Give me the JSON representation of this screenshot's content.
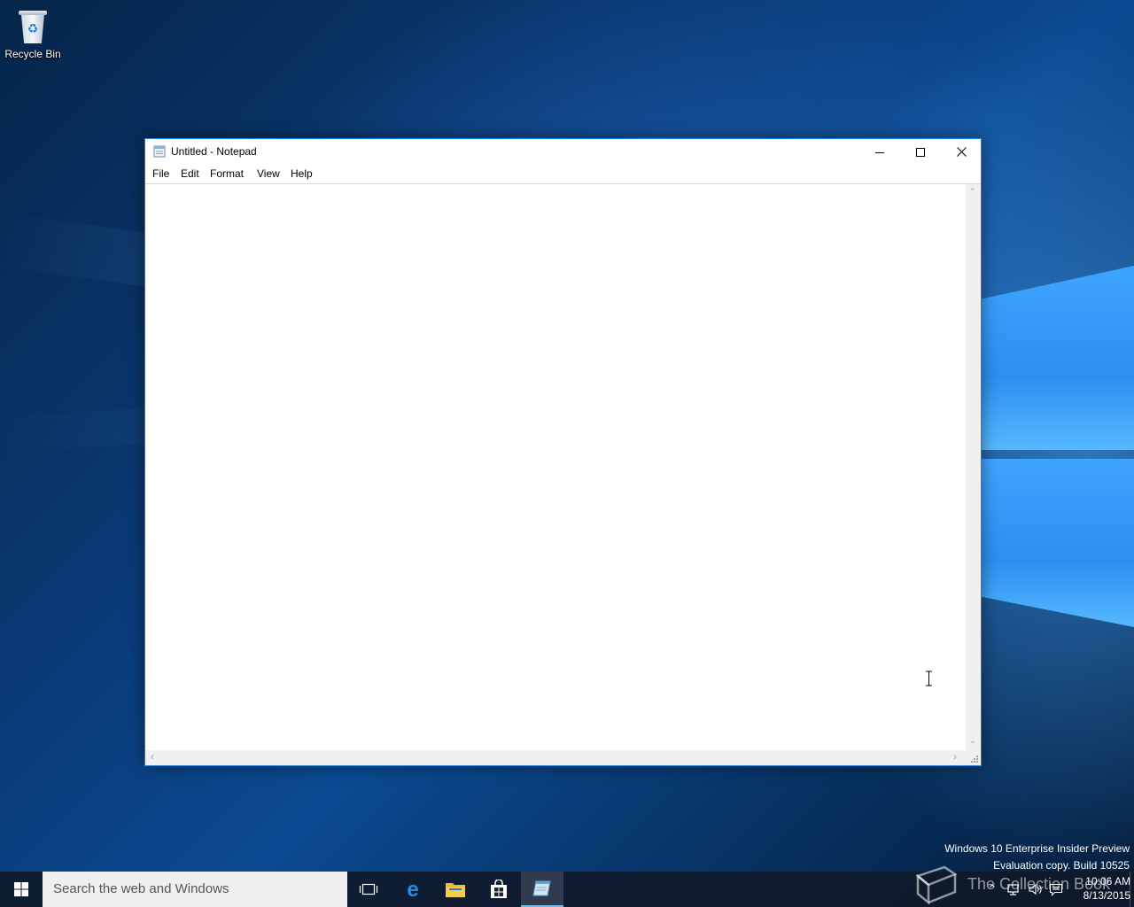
{
  "desktop": {
    "icons": [
      {
        "label": "Recycle Bin",
        "icon": "recycle-bin-icon"
      }
    ],
    "watermark": {
      "line1": "Windows 10 Enterprise Insider Preview",
      "line2": "Evaluation copy. Build 10525"
    },
    "site_watermark": "The Collection Book"
  },
  "notepad": {
    "title": "Untitled - Notepad",
    "menu": [
      {
        "label": "File"
      },
      {
        "label": "Edit"
      },
      {
        "label": "Format"
      },
      {
        "label": "View"
      },
      {
        "label": "Help"
      }
    ],
    "content": ""
  },
  "taskbar": {
    "search_placeholder": "Search the web and Windows",
    "clock": {
      "time": "10:06 AM",
      "date": "8/13/2015"
    }
  },
  "colors": {
    "accent": "#1883d7",
    "taskbar": "#101828",
    "search_bg": "#f0f0f0"
  }
}
